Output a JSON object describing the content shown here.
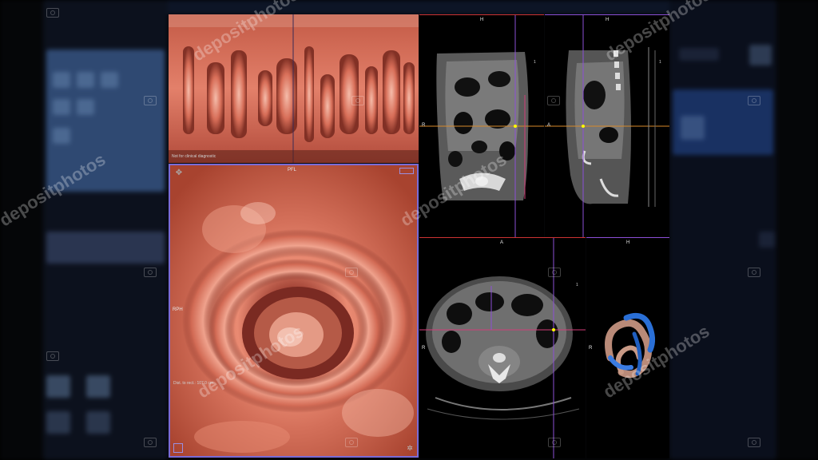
{
  "flat_view": {
    "status_text": "Not for clinical diagnostic"
  },
  "endo_view": {
    "top_orientation": "PFL",
    "left_orientation": "RPH",
    "distance_text": "Dist. to rect.: 107.0 cm"
  },
  "coronal_view": {
    "top_orientation": "H",
    "left_orientation": "R",
    "marker_label": "1"
  },
  "sagittal_view": {
    "top_orientation": "H",
    "left_orientation": "A",
    "marker_label": "1"
  },
  "axial_view": {
    "top_orientation": "A",
    "left_orientation": "R",
    "marker_label": "1"
  },
  "volume_view": {
    "top_orientation": "H",
    "left_orientation": "R"
  },
  "watermark": {
    "text": "depositphotos"
  },
  "colors": {
    "tissue": "#e57a63",
    "frame_active": "#7a6bd6",
    "crosshair_orange": "#d88a2a",
    "crosshair_purple": "#8c4fd6",
    "crosshair_magenta": "#d23c78"
  }
}
